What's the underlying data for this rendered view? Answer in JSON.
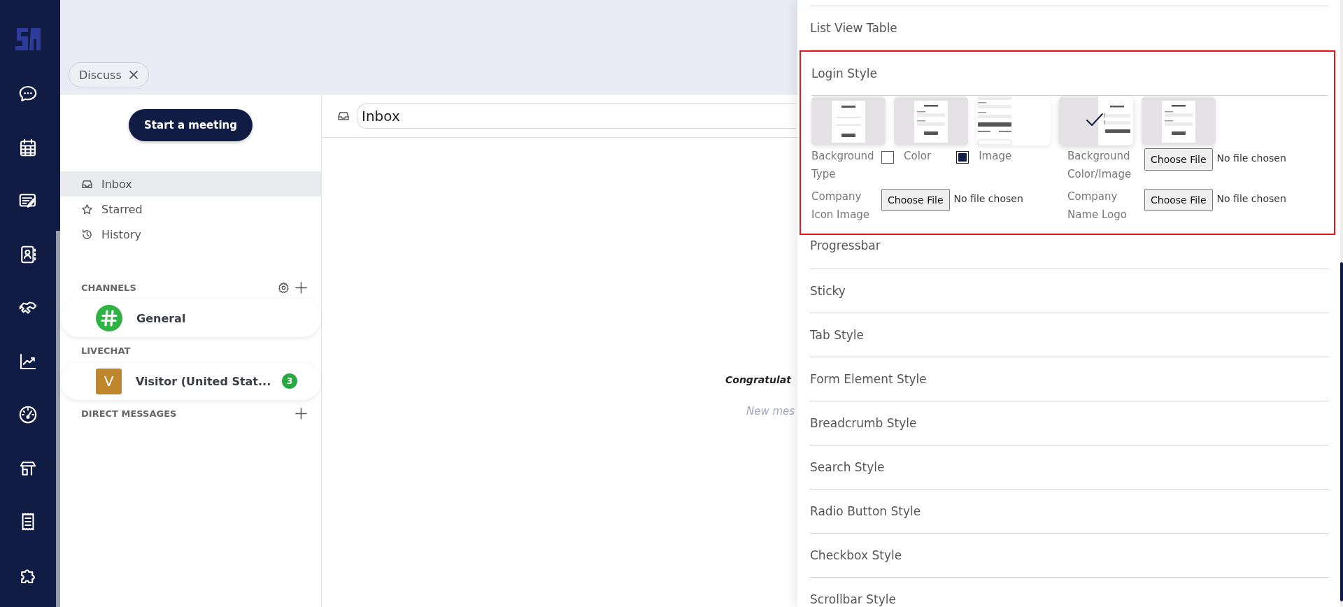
{
  "tabs": [
    {
      "label": "Discuss"
    }
  ],
  "sidebar": {
    "button": "Start a meeting",
    "mailboxes": [
      {
        "label": "Inbox",
        "kind": "inbox",
        "selected": true
      },
      {
        "label": "Starred",
        "kind": "starred",
        "selected": false
      },
      {
        "label": "History",
        "kind": "history",
        "selected": false
      }
    ],
    "sections": [
      {
        "title": "CHANNELS",
        "settings": true,
        "add": true,
        "items": [
          {
            "name": "General",
            "kind": "channel"
          }
        ]
      },
      {
        "title": "LIVECHAT",
        "settings": false,
        "add": false,
        "items": [
          {
            "name": "Visitor (United Stat...",
            "kind": "visitor",
            "avatar": "V",
            "badge": "3"
          }
        ]
      },
      {
        "title": "DIRECT MESSAGES",
        "settings": false,
        "add": true
      }
    ]
  },
  "thread": {
    "title": "Inbox",
    "empty_title": "Congratulat",
    "empty_subtitle": "New mes"
  },
  "settings": {
    "items": [
      {
        "title": "List View Table",
        "kind": "collapsed"
      },
      {
        "title": "Login Style",
        "kind": "expanded",
        "highlighted": true,
        "layouts": [
          {
            "kind": "centered",
            "selected": false
          },
          {
            "kind": "form",
            "selected": false
          },
          {
            "kind": "full",
            "selected": false
          },
          {
            "kind": "split",
            "selected": true
          },
          {
            "kind": "form",
            "selected": false
          }
        ],
        "fields": [
          {
            "label": "Background Type",
            "kind": "choice",
            "options": [
              {
                "label": "Color",
                "checked": false
              },
              {
                "label": "Image",
                "checked": true
              }
            ]
          },
          {
            "label": "Background Color/Image",
            "kind": "file",
            "button": "Choose File",
            "status": "No file chosen"
          },
          {
            "label": "Company Icon Image",
            "kind": "file",
            "button": "Choose File",
            "status": "No file chosen"
          },
          {
            "label": "Company Name Logo",
            "kind": "file",
            "button": "Choose File",
            "status": "No file chosen"
          }
        ]
      },
      {
        "title": "Progressbar",
        "kind": "collapsed"
      },
      {
        "title": "Sticky",
        "kind": "collapsed"
      },
      {
        "title": "Tab Style",
        "kind": "collapsed"
      },
      {
        "title": "Form Element Style",
        "kind": "collapsed"
      },
      {
        "title": "Breadcrumb Style",
        "kind": "collapsed"
      },
      {
        "title": "Search Style",
        "kind": "collapsed"
      },
      {
        "title": "Radio Button Style",
        "kind": "collapsed"
      },
      {
        "title": "Checkbox Style",
        "kind": "collapsed"
      },
      {
        "title": "Scrollbar Style",
        "kind": "collapsed"
      }
    ]
  }
}
